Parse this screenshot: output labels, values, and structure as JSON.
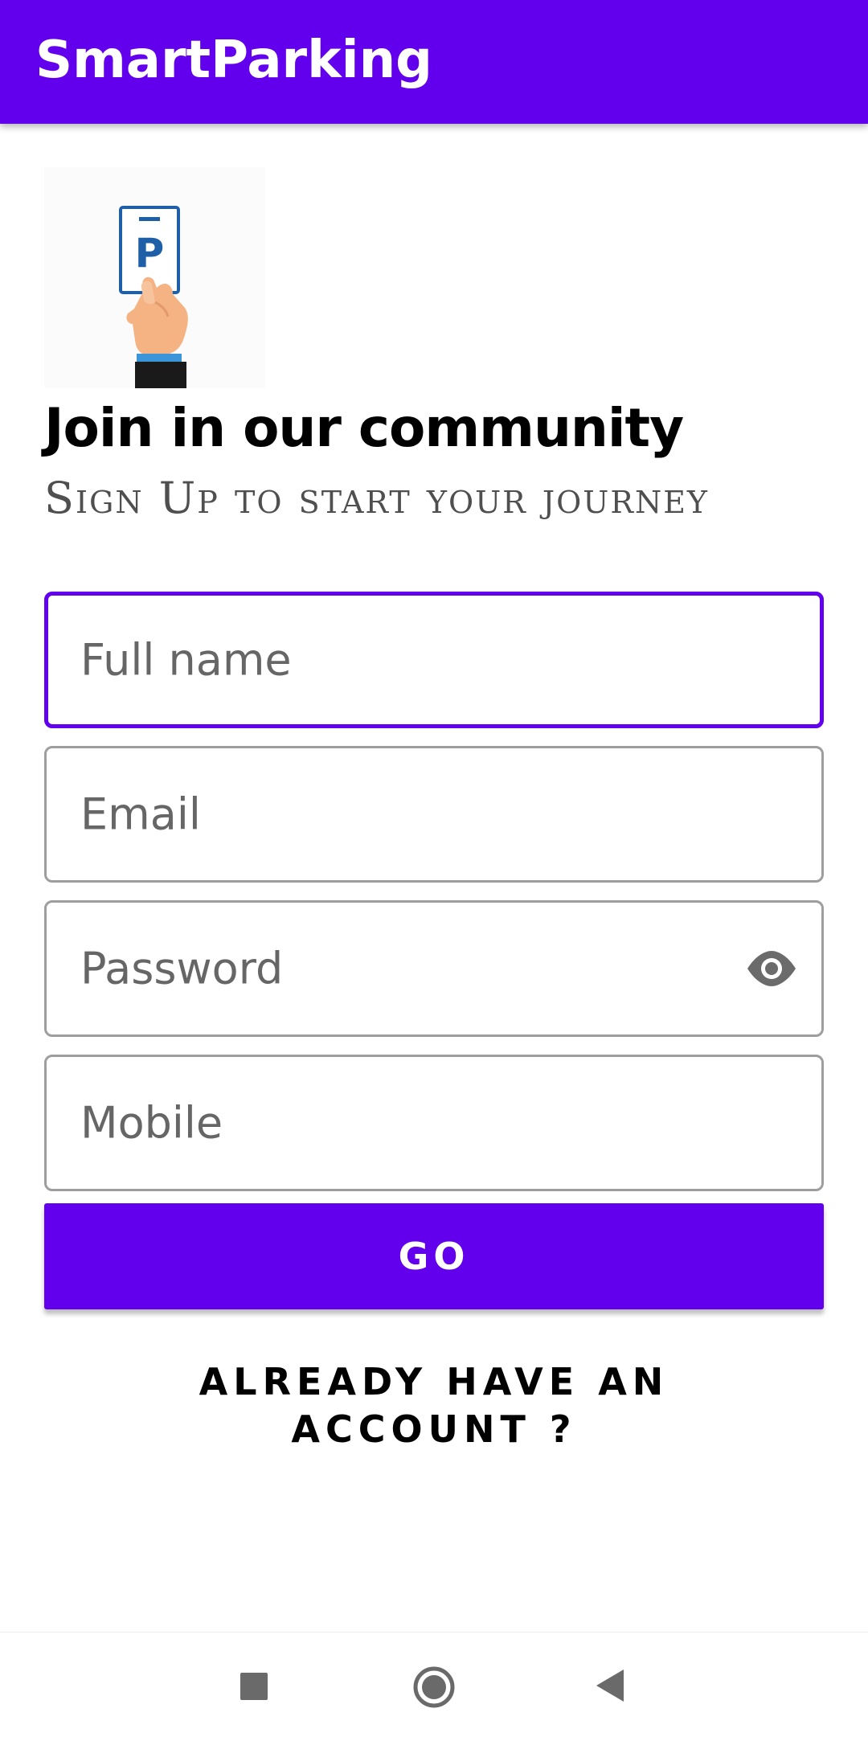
{
  "app_bar": {
    "title": "SmartParking",
    "background_color": "#6200EE"
  },
  "logo": {
    "icon": "parking-card-hand-icon",
    "letter": "P"
  },
  "header": {
    "title": "Join in our community",
    "subtitle": "Sign Up to start your journey"
  },
  "form": {
    "fields": [
      {
        "placeholder": "Full name",
        "value": "",
        "focused": true
      },
      {
        "placeholder": "Email",
        "value": ""
      },
      {
        "placeholder": "Password",
        "value": "",
        "trailing_icon": "eye-icon"
      },
      {
        "placeholder": "Mobile",
        "value": ""
      }
    ],
    "submit_label": "GO",
    "accent_color": "#6200EE"
  },
  "links": {
    "already_have_account": "ALREADY HAVE AN ACCOUNT ?"
  },
  "navigation_bar": {
    "buttons": [
      "recent-apps-square-icon",
      "home-circle-icon",
      "back-triangle-icon"
    ]
  }
}
